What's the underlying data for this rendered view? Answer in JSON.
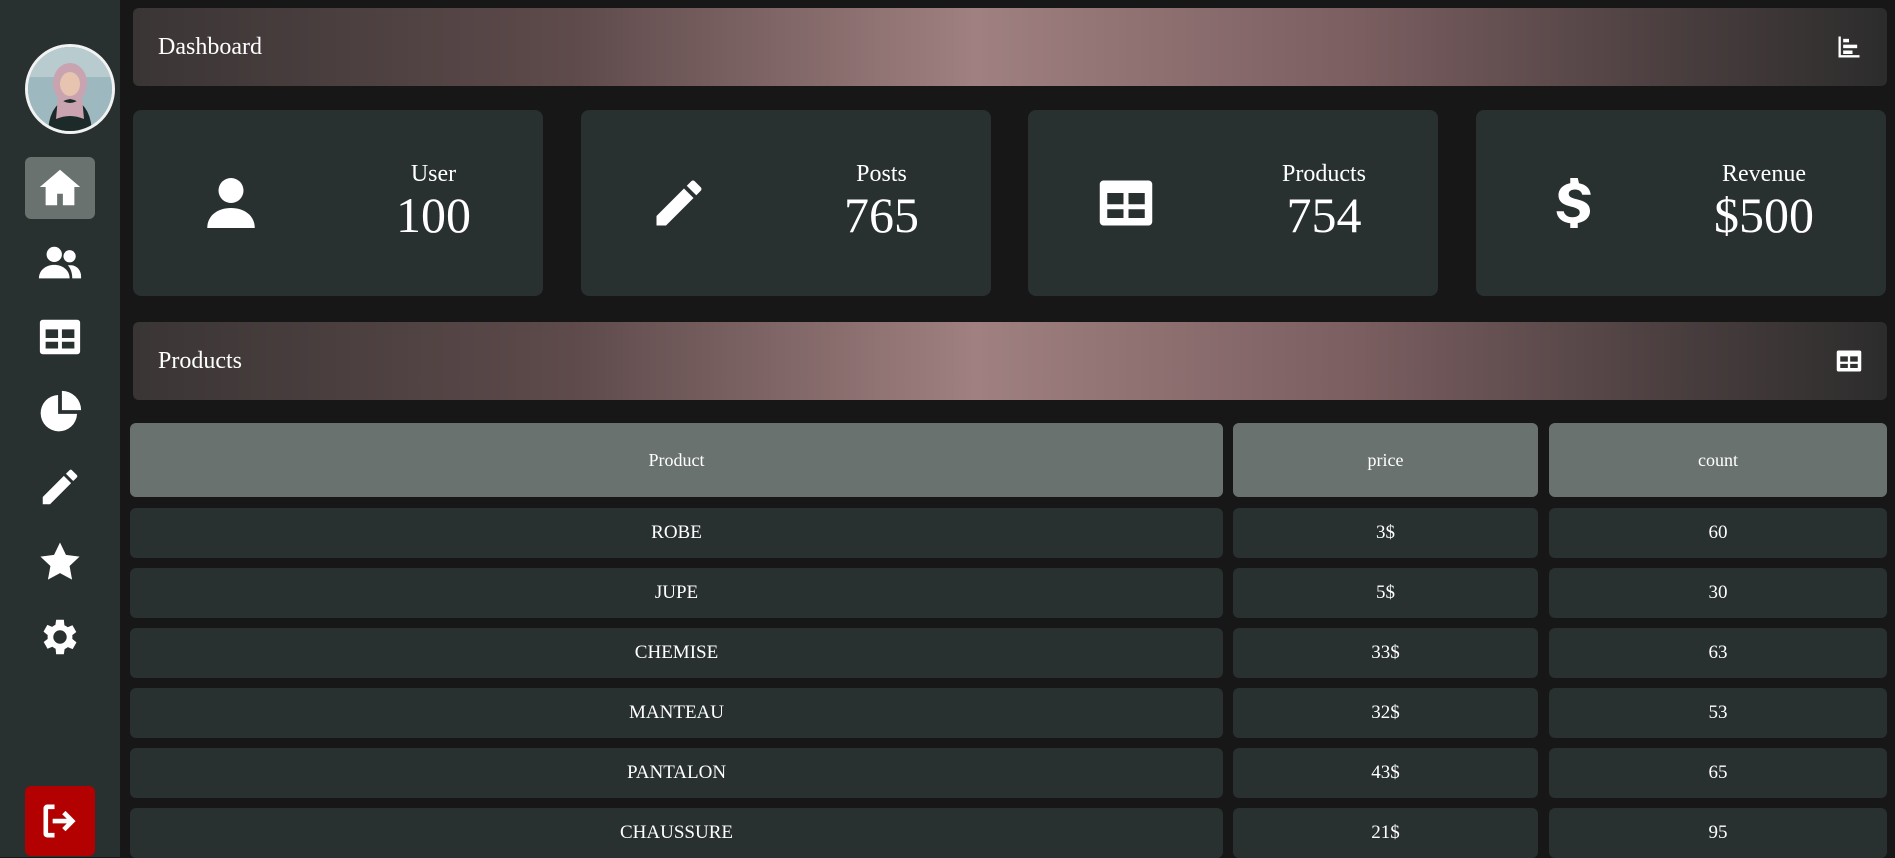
{
  "dashboard_header": {
    "title": "Dashboard",
    "icon": "bar-chart-icon"
  },
  "sidebar": {
    "items": [
      {
        "icon": "home-icon",
        "active": true
      },
      {
        "icon": "users-icon",
        "active": false
      },
      {
        "icon": "table-icon",
        "active": false
      },
      {
        "icon": "pie-chart-icon",
        "active": false
      },
      {
        "icon": "pencil-icon",
        "active": false
      },
      {
        "icon": "star-icon",
        "active": false
      },
      {
        "icon": "gear-icon",
        "active": false
      }
    ],
    "logout_icon": "logout-icon"
  },
  "cards": [
    {
      "label": "User",
      "value": "100",
      "icon": "user-icon"
    },
    {
      "label": "Posts",
      "value": "765",
      "icon": "pencil-icon"
    },
    {
      "label": "Products",
      "value": "754",
      "icon": "table-icon"
    },
    {
      "label": "Revenue",
      "value": "$500",
      "icon": "dollar-icon"
    }
  ],
  "products_header": {
    "title": "Products",
    "icon": "table-icon"
  },
  "table": {
    "columns": [
      "Product",
      "price",
      "count"
    ],
    "rows": [
      [
        "ROBE",
        "3$",
        "60"
      ],
      [
        "JUPE",
        "5$",
        "30"
      ],
      [
        "CHEMISE",
        "33$",
        "63"
      ],
      [
        "MANTEAU",
        "32$",
        "53"
      ],
      [
        "PANTALON",
        "43$",
        "65"
      ],
      [
        "CHAUSSURE",
        "21$",
        "95"
      ]
    ]
  },
  "colors": {
    "background": "#171717",
    "panel": "#293030",
    "header_cell": "#6a7270",
    "logout": "#b30000"
  }
}
